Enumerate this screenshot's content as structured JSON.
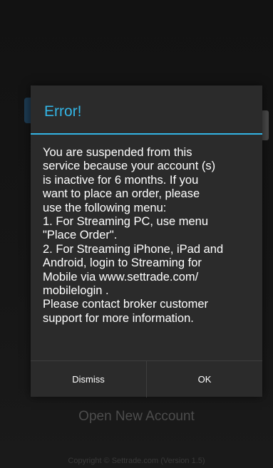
{
  "background": {
    "open_account_label": "Open New Account",
    "copyright": "Copyright © Settrade.com (Version 1.5)"
  },
  "dialog": {
    "title": "Error!",
    "message": "You are suspended from this\nservice because your account (s)\nis inactive for 6 months. If you\nwant to place an order, please\nuse the following menu:\n1. For Streaming PC, use menu\n\"Place Order\".\n2. For Streaming iPhone, iPad and\nAndroid,  login to Streaming for\nMobile via www.settrade.com/\nmobilelogin .\nPlease contact broker customer\nsupport for more information.",
    "buttons": {
      "dismiss": "Dismiss",
      "ok": "OK"
    }
  },
  "colors": {
    "accent": "#33b5e5",
    "dialog_background": "#2b2b2b",
    "screen_background": "#141414"
  }
}
